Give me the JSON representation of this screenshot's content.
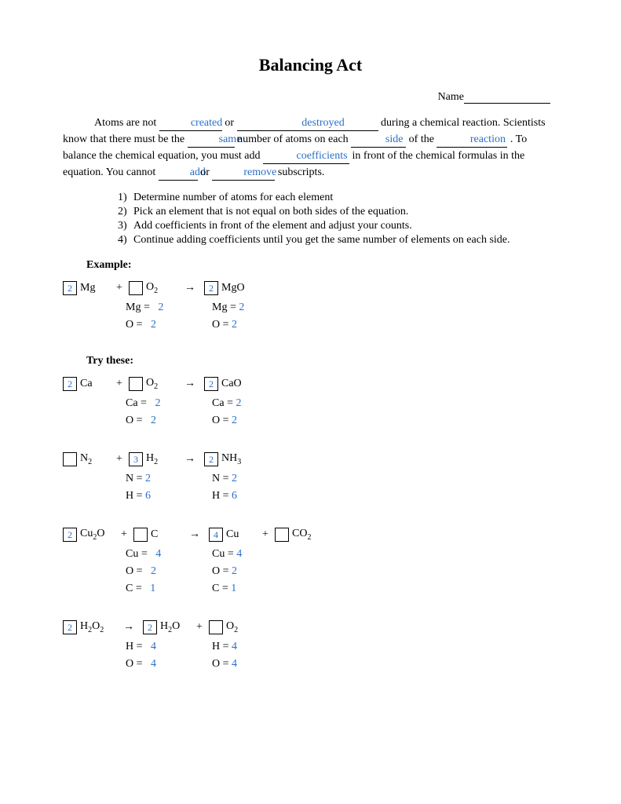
{
  "title": "Balancing Act",
  "name_label": "Name",
  "paragraph": {
    "t1": "Atoms are not ",
    "b1": "created",
    "t2": " or ",
    "b2": "destroyed",
    "t3": " during a chemical reaction. Scientists know that there must be the ",
    "b3": "same",
    "t4": " number of atoms on each ",
    "b4": "side",
    "t5": " of the ",
    "b5": "reaction",
    "t6": ". To balance the chemical equation, you must add ",
    "b6": "coefficients",
    "t7": " in front of the chemical formulas in the equation. You cannot ",
    "b7": "add",
    "t8": " or ",
    "b8": "remove",
    "t9": " subscripts."
  },
  "steps": [
    "Determine number of atoms for each element",
    "Pick an element that is not equal on both sides of the equation.",
    "Add coefficients in front of the element and adjust your counts.",
    "Continue adding coefficients until you get the same number of elements on each side."
  ],
  "example_label": "Example:",
  "try_label": "Try these:",
  "ex1": {
    "c1": "2",
    "f1": "Mg",
    "c2": "",
    "f2": "O",
    "f2s": "2",
    "c3": "2",
    "f3": "MgO",
    "counts": [
      {
        "el": "Mg =",
        "lv": "2",
        "rl": "Mg =",
        "rv": "2"
      },
      {
        "el": "O =",
        "lv": "2",
        "rl": "O =",
        "rv": "2"
      }
    ]
  },
  "p1": {
    "c1": "2",
    "f1": "Ca",
    "c2": "",
    "f2": "O",
    "f2s": "2",
    "c3": "2",
    "f3": "CaO",
    "counts": [
      {
        "el": "Ca =",
        "lv": "2",
        "rl": "Ca =",
        "rv": "2"
      },
      {
        "el": "O =",
        "lv": "2",
        "rl": "O =",
        "rv": "2"
      }
    ]
  },
  "p2": {
    "c1": "",
    "f1": "N",
    "f1s": "2",
    "c2": "3",
    "f2": "H",
    "f2s": "2",
    "c3": "2",
    "f3": "NH",
    "f3s": "3",
    "counts": [
      {
        "el": "N =",
        "lv": "2",
        "rl": "N =",
        "rv": "2"
      },
      {
        "el": "H =",
        "lv": "6",
        "rl": "H =",
        "rv": "6"
      }
    ]
  },
  "p3": {
    "c1": "2",
    "f1a": "Cu",
    "f1s1": "2",
    "f1b": "O",
    "c2": "",
    "f2": "C",
    "c3": "4",
    "f3": "Cu",
    "c4": "",
    "f4": "CO",
    "f4s": "2",
    "counts": [
      {
        "el": "Cu =",
        "lv": "4",
        "rl": "Cu =",
        "rv": "4"
      },
      {
        "el": "O =",
        "lv": "2",
        "rl": "O =",
        "rv": "2"
      },
      {
        "el": "C =",
        "lv": "1",
        "rl": "C =",
        "rv": "1"
      }
    ]
  },
  "p4": {
    "c1": "2",
    "f1a": "H",
    "f1s1": "2",
    "f1b": "O",
    "f1s2": "2",
    "c2": "2",
    "f2a": "H",
    "f2s": "2",
    "f2b": "O",
    "c3": "",
    "f3": "O",
    "f3s": "2",
    "counts": [
      {
        "el": "H =",
        "lv": "4",
        "rl": "H =",
        "rv": "4"
      },
      {
        "el": "O =",
        "lv": "4",
        "rl": "O =",
        "rv": "4"
      }
    ]
  }
}
